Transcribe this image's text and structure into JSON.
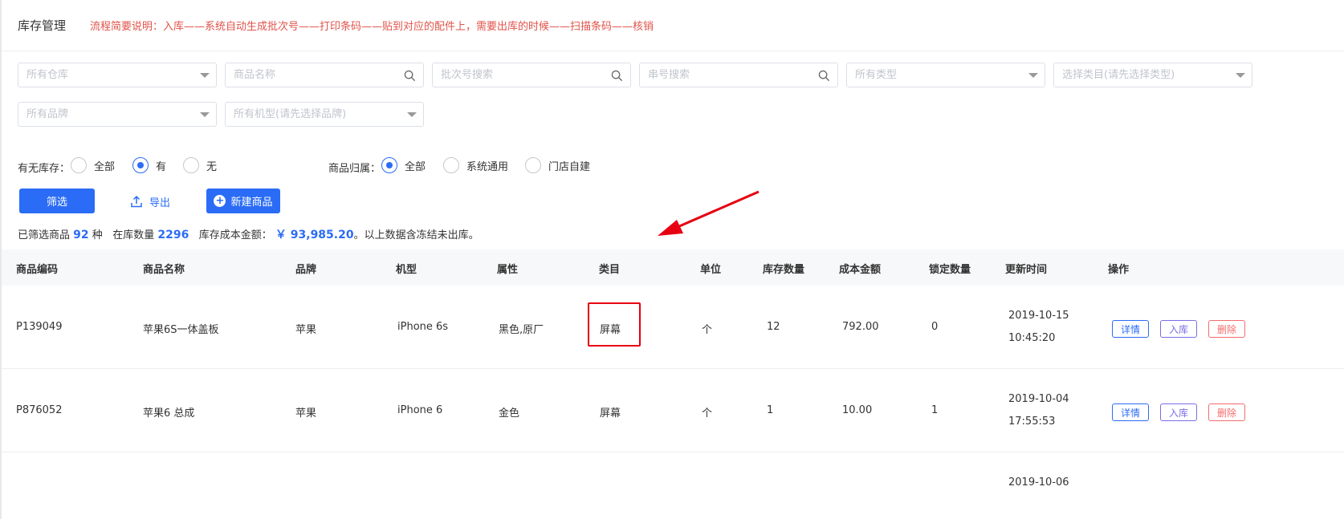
{
  "header": {
    "title": "库存管理",
    "note": "流程简要说明：入库——系统自动生成批次号——打印条码——贴到对应的配件上，需要出库的时候——扫描条码——核销"
  },
  "filters": {
    "warehouse": "所有仓库",
    "product_name": "商品名称",
    "batch_search": "批次号搜索",
    "serial_search": "串号搜索",
    "type": "所有类型",
    "category": "选择类目(请先选择类型)",
    "brand": "所有品牌",
    "model": "所有机型(请先选择品牌)"
  },
  "stock_filter": {
    "label": "有无库存：",
    "options": [
      "全部",
      "有",
      "无"
    ],
    "selected": "有"
  },
  "ownership_filter": {
    "label": "商品归属：",
    "options": [
      "全部",
      "系统通用",
      "门店自建"
    ],
    "selected": "全部"
  },
  "actions": {
    "filter": "筛选",
    "export": "导出",
    "new_product": "新建商品"
  },
  "summary": {
    "t1": "已筛选商品",
    "count": "92",
    "t2": "种",
    "t3": "在库数量",
    "quantity": "2296",
    "t4": "库存成本金额：",
    "amount": "￥ 93,985.20",
    "t5": "。以上数据含冻结未出库。"
  },
  "table": {
    "columns": [
      "商品编码",
      "商品名称",
      "品牌",
      "机型",
      "属性",
      "类目",
      "单位",
      "库存数量",
      "成本金额",
      "锁定数量",
      "更新时间",
      "操作"
    ],
    "rows": [
      {
        "code": "P139049",
        "name": "苹果6S一体盖板",
        "brand": "苹果",
        "model": "iPhone 6s",
        "attr": "黑色,原厂",
        "category": "屏幕",
        "unit": "个",
        "stock": "12",
        "cost": "792.00",
        "locked": "0",
        "date": "2019-10-15",
        "time": "10:45:20"
      },
      {
        "code": "P876052",
        "name": "苹果6 总成",
        "brand": "苹果",
        "model": "iPhone 6",
        "attr": "金色",
        "category": "屏幕",
        "unit": "个",
        "stock": "1",
        "cost": "10.00",
        "locked": "1",
        "date": "2019-10-04",
        "time": "17:55:53"
      },
      {
        "date": "2019-10-06"
      }
    ],
    "row_actions": {
      "detail": "详情",
      "instock": "入库",
      "delete": "删除"
    }
  },
  "colors": {
    "primary": "#2b6cf6",
    "note_red": "#e0534a",
    "highlight_red": "#e60012",
    "purple": "#7a6ee6",
    "danger": "#f56c6c"
  }
}
